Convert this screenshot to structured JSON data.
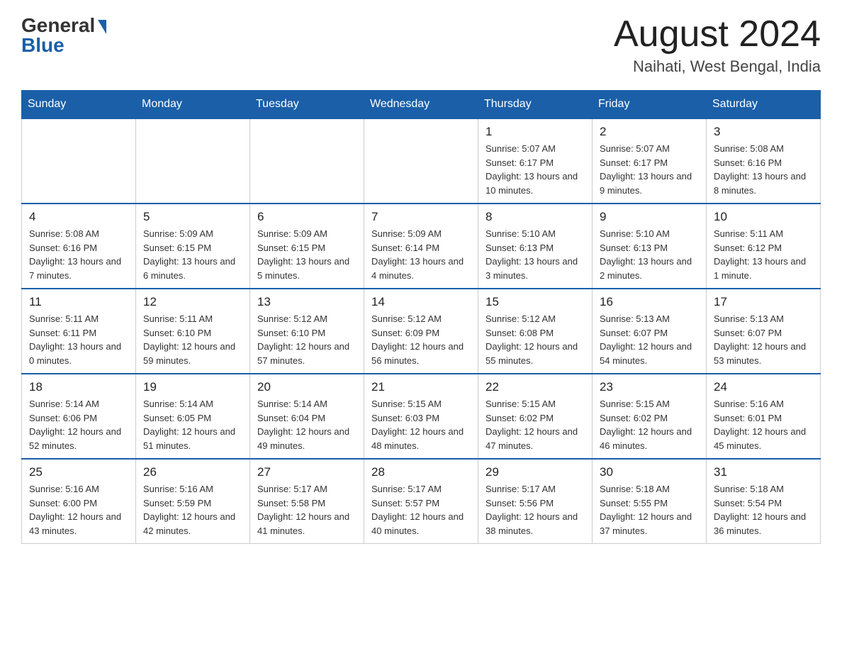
{
  "header": {
    "logo_text_general": "General",
    "logo_text_blue": "Blue",
    "month_title": "August 2024",
    "location": "Naihati, West Bengal, India"
  },
  "weekdays": [
    "Sunday",
    "Monday",
    "Tuesday",
    "Wednesday",
    "Thursday",
    "Friday",
    "Saturday"
  ],
  "weeks": [
    [
      {
        "day": "",
        "sunrise": "",
        "sunset": "",
        "daylight": ""
      },
      {
        "day": "",
        "sunrise": "",
        "sunset": "",
        "daylight": ""
      },
      {
        "day": "",
        "sunrise": "",
        "sunset": "",
        "daylight": ""
      },
      {
        "day": "",
        "sunrise": "",
        "sunset": "",
        "daylight": ""
      },
      {
        "day": "1",
        "sunrise": "Sunrise: 5:07 AM",
        "sunset": "Sunset: 6:17 PM",
        "daylight": "Daylight: 13 hours and 10 minutes."
      },
      {
        "day": "2",
        "sunrise": "Sunrise: 5:07 AM",
        "sunset": "Sunset: 6:17 PM",
        "daylight": "Daylight: 13 hours and 9 minutes."
      },
      {
        "day": "3",
        "sunrise": "Sunrise: 5:08 AM",
        "sunset": "Sunset: 6:16 PM",
        "daylight": "Daylight: 13 hours and 8 minutes."
      }
    ],
    [
      {
        "day": "4",
        "sunrise": "Sunrise: 5:08 AM",
        "sunset": "Sunset: 6:16 PM",
        "daylight": "Daylight: 13 hours and 7 minutes."
      },
      {
        "day": "5",
        "sunrise": "Sunrise: 5:09 AM",
        "sunset": "Sunset: 6:15 PM",
        "daylight": "Daylight: 13 hours and 6 minutes."
      },
      {
        "day": "6",
        "sunrise": "Sunrise: 5:09 AM",
        "sunset": "Sunset: 6:15 PM",
        "daylight": "Daylight: 13 hours and 5 minutes."
      },
      {
        "day": "7",
        "sunrise": "Sunrise: 5:09 AM",
        "sunset": "Sunset: 6:14 PM",
        "daylight": "Daylight: 13 hours and 4 minutes."
      },
      {
        "day": "8",
        "sunrise": "Sunrise: 5:10 AM",
        "sunset": "Sunset: 6:13 PM",
        "daylight": "Daylight: 13 hours and 3 minutes."
      },
      {
        "day": "9",
        "sunrise": "Sunrise: 5:10 AM",
        "sunset": "Sunset: 6:13 PM",
        "daylight": "Daylight: 13 hours and 2 minutes."
      },
      {
        "day": "10",
        "sunrise": "Sunrise: 5:11 AM",
        "sunset": "Sunset: 6:12 PM",
        "daylight": "Daylight: 13 hours and 1 minute."
      }
    ],
    [
      {
        "day": "11",
        "sunrise": "Sunrise: 5:11 AM",
        "sunset": "Sunset: 6:11 PM",
        "daylight": "Daylight: 13 hours and 0 minutes."
      },
      {
        "day": "12",
        "sunrise": "Sunrise: 5:11 AM",
        "sunset": "Sunset: 6:10 PM",
        "daylight": "Daylight: 12 hours and 59 minutes."
      },
      {
        "day": "13",
        "sunrise": "Sunrise: 5:12 AM",
        "sunset": "Sunset: 6:10 PM",
        "daylight": "Daylight: 12 hours and 57 minutes."
      },
      {
        "day": "14",
        "sunrise": "Sunrise: 5:12 AM",
        "sunset": "Sunset: 6:09 PM",
        "daylight": "Daylight: 12 hours and 56 minutes."
      },
      {
        "day": "15",
        "sunrise": "Sunrise: 5:12 AM",
        "sunset": "Sunset: 6:08 PM",
        "daylight": "Daylight: 12 hours and 55 minutes."
      },
      {
        "day": "16",
        "sunrise": "Sunrise: 5:13 AM",
        "sunset": "Sunset: 6:07 PM",
        "daylight": "Daylight: 12 hours and 54 minutes."
      },
      {
        "day": "17",
        "sunrise": "Sunrise: 5:13 AM",
        "sunset": "Sunset: 6:07 PM",
        "daylight": "Daylight: 12 hours and 53 minutes."
      }
    ],
    [
      {
        "day": "18",
        "sunrise": "Sunrise: 5:14 AM",
        "sunset": "Sunset: 6:06 PM",
        "daylight": "Daylight: 12 hours and 52 minutes."
      },
      {
        "day": "19",
        "sunrise": "Sunrise: 5:14 AM",
        "sunset": "Sunset: 6:05 PM",
        "daylight": "Daylight: 12 hours and 51 minutes."
      },
      {
        "day": "20",
        "sunrise": "Sunrise: 5:14 AM",
        "sunset": "Sunset: 6:04 PM",
        "daylight": "Daylight: 12 hours and 49 minutes."
      },
      {
        "day": "21",
        "sunrise": "Sunrise: 5:15 AM",
        "sunset": "Sunset: 6:03 PM",
        "daylight": "Daylight: 12 hours and 48 minutes."
      },
      {
        "day": "22",
        "sunrise": "Sunrise: 5:15 AM",
        "sunset": "Sunset: 6:02 PM",
        "daylight": "Daylight: 12 hours and 47 minutes."
      },
      {
        "day": "23",
        "sunrise": "Sunrise: 5:15 AM",
        "sunset": "Sunset: 6:02 PM",
        "daylight": "Daylight: 12 hours and 46 minutes."
      },
      {
        "day": "24",
        "sunrise": "Sunrise: 5:16 AM",
        "sunset": "Sunset: 6:01 PM",
        "daylight": "Daylight: 12 hours and 45 minutes."
      }
    ],
    [
      {
        "day": "25",
        "sunrise": "Sunrise: 5:16 AM",
        "sunset": "Sunset: 6:00 PM",
        "daylight": "Daylight: 12 hours and 43 minutes."
      },
      {
        "day": "26",
        "sunrise": "Sunrise: 5:16 AM",
        "sunset": "Sunset: 5:59 PM",
        "daylight": "Daylight: 12 hours and 42 minutes."
      },
      {
        "day": "27",
        "sunrise": "Sunrise: 5:17 AM",
        "sunset": "Sunset: 5:58 PM",
        "daylight": "Daylight: 12 hours and 41 minutes."
      },
      {
        "day": "28",
        "sunrise": "Sunrise: 5:17 AM",
        "sunset": "Sunset: 5:57 PM",
        "daylight": "Daylight: 12 hours and 40 minutes."
      },
      {
        "day": "29",
        "sunrise": "Sunrise: 5:17 AM",
        "sunset": "Sunset: 5:56 PM",
        "daylight": "Daylight: 12 hours and 38 minutes."
      },
      {
        "day": "30",
        "sunrise": "Sunrise: 5:18 AM",
        "sunset": "Sunset: 5:55 PM",
        "daylight": "Daylight: 12 hours and 37 minutes."
      },
      {
        "day": "31",
        "sunrise": "Sunrise: 5:18 AM",
        "sunset": "Sunset: 5:54 PM",
        "daylight": "Daylight: 12 hours and 36 minutes."
      }
    ]
  ]
}
